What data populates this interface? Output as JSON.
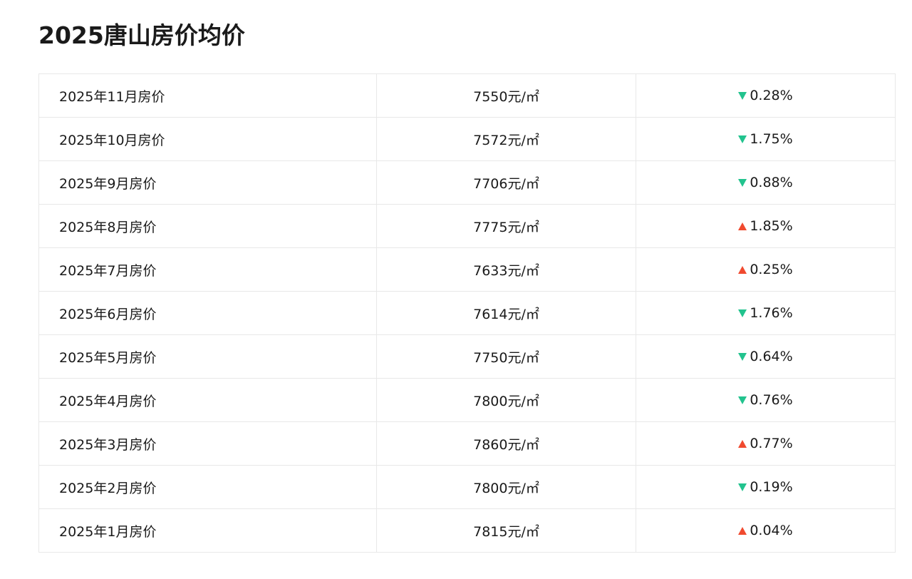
{
  "page": {
    "title": "2025唐山房价均价"
  },
  "colors": {
    "down": "#22c38e",
    "up": "#f04a2f",
    "border": "#e8e8e8"
  },
  "rows": [
    {
      "month": "2025年11月房价",
      "price": "7550元/㎡",
      "direction": "down",
      "direction_icon": "triangle-down-icon",
      "change": "0.28%"
    },
    {
      "month": "2025年10月房价",
      "price": "7572元/㎡",
      "direction": "down",
      "direction_icon": "triangle-down-icon",
      "change": "1.75%"
    },
    {
      "month": "2025年9月房价",
      "price": "7706元/㎡",
      "direction": "down",
      "direction_icon": "triangle-down-icon",
      "change": "0.88%"
    },
    {
      "month": "2025年8月房价",
      "price": "7775元/㎡",
      "direction": "up",
      "direction_icon": "triangle-up-icon",
      "change": "1.85%"
    },
    {
      "month": "2025年7月房价",
      "price": "7633元/㎡",
      "direction": "up",
      "direction_icon": "triangle-up-icon",
      "change": "0.25%"
    },
    {
      "month": "2025年6月房价",
      "price": "7614元/㎡",
      "direction": "down",
      "direction_icon": "triangle-down-icon",
      "change": "1.76%"
    },
    {
      "month": "2025年5月房价",
      "price": "7750元/㎡",
      "direction": "down",
      "direction_icon": "triangle-down-icon",
      "change": "0.64%"
    },
    {
      "month": "2025年4月房价",
      "price": "7800元/㎡",
      "direction": "down",
      "direction_icon": "triangle-down-icon",
      "change": "0.76%"
    },
    {
      "month": "2025年3月房价",
      "price": "7860元/㎡",
      "direction": "up",
      "direction_icon": "triangle-up-icon",
      "change": "0.77%"
    },
    {
      "month": "2025年2月房价",
      "price": "7800元/㎡",
      "direction": "down",
      "direction_icon": "triangle-down-icon",
      "change": "0.19%"
    },
    {
      "month": "2025年1月房价",
      "price": "7815元/㎡",
      "direction": "up",
      "direction_icon": "triangle-up-icon",
      "change": "0.04%"
    }
  ]
}
